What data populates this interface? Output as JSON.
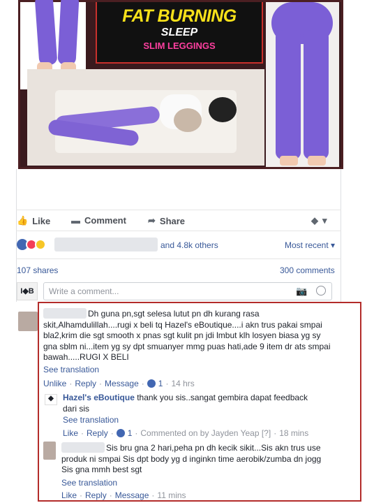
{
  "banner": {
    "title": "FAT BURNING",
    "subtitle": "SLEEP",
    "tagline": "SLIM LEGGINGS"
  },
  "actions": {
    "like": "Like",
    "comment": "Comment",
    "share": "Share"
  },
  "reactions": {
    "others": "and 4.8k others",
    "sort": "Most recent"
  },
  "stats": {
    "shares": "107 shares",
    "comments": "300 comments"
  },
  "composer": {
    "placeholder": "Write a comment..."
  },
  "comments": [
    {
      "text": "Dh guna pn,sgt selesa lutut pn dh kurang rasa skit,Alhamdulillah....rugi x beli tq Hazel's eBoutique....i akn trus pakai smpai bla2,krim die sgt smooth x pnas sgt kulit pn jdi lmbut klh losyen biasa yg sy gna sblm ni...item yg sy dpt smuanyer mmg puas hati,ade 9 item dr ats smpai bawah.....RUGI X BELI",
      "see_translation": "See translation",
      "unlike": "Unlike",
      "reply": "Reply",
      "message": "Message",
      "count": "1",
      "time": "14 hrs"
    },
    {
      "author": "Hazel's eBoutique",
      "text": "thank you sis..sangat gembira dapat feedback dari sis",
      "see_translation": "See translation",
      "like": "Like",
      "reply": "Reply",
      "count": "1",
      "commented_on": "Commented on by Jayden Yeap [?]",
      "time": "18 mins"
    },
    {
      "text": "Sis bru gna 2 hari,peha pn dh kecik sikit...Sis akn trus use produk ni smpai Sis dpt body yg d inginkn time aerobik/zumba dn jogg Sis gna mmh best sgt",
      "see_translation": "See translation",
      "like": "Like",
      "reply": "Reply",
      "message": "Message",
      "time": "11 mins"
    }
  ]
}
